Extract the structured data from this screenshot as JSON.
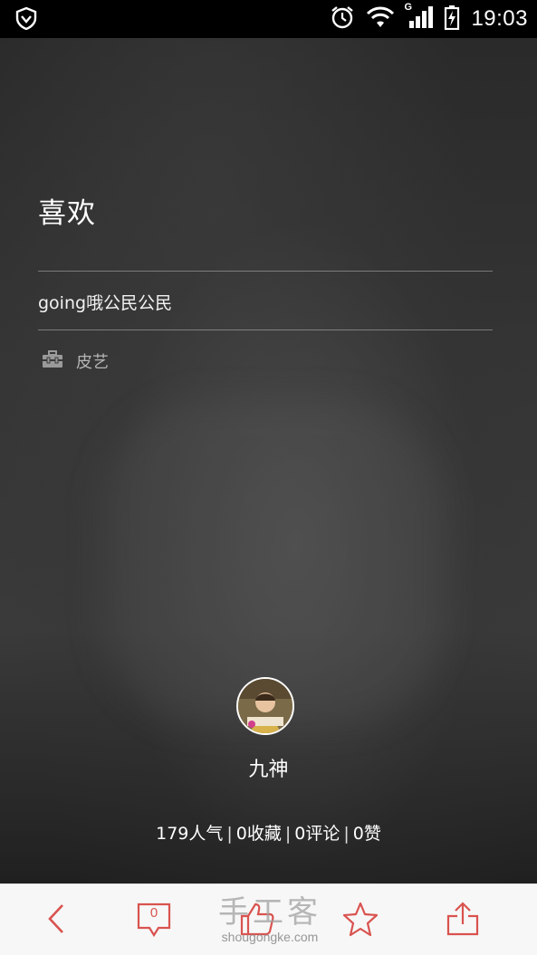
{
  "status_bar": {
    "network_label": "G",
    "time": "19:03"
  },
  "main": {
    "title": "喜欢",
    "description": "going哦公民公民",
    "category": "皮艺",
    "author": "九神",
    "stats": {
      "popularity": "179人气",
      "favorites": "0收藏",
      "comments": "0评论",
      "likes": "0赞",
      "separator": "|"
    }
  },
  "toolbar": {
    "comment_count": "0",
    "accent_color": "#d9534f"
  },
  "watermark": {
    "chinese": "手工客",
    "domain": "shougongke.com"
  }
}
